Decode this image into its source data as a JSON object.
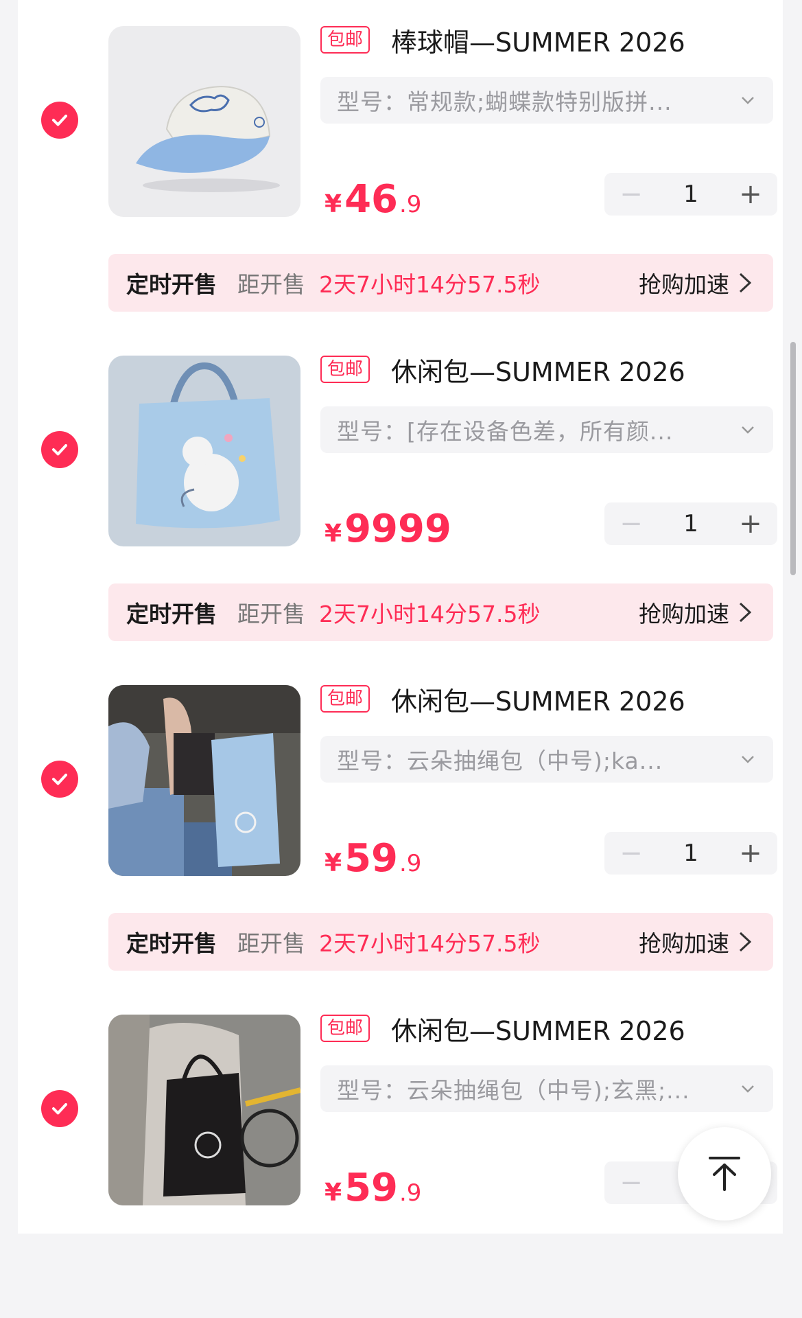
{
  "items": [
    {
      "badge": "包邮",
      "title": "棒球帽—SUMMER 2026",
      "variant": "型号：常规款;蝴蝶款特别版拼...",
      "price": {
        "currency": "¥",
        "integer": "46",
        "decimal": ".9"
      },
      "quantity": "1",
      "timer": {
        "label": "定时开售",
        "prefix": "距开售",
        "countdown": "2天7小时14分57.5秒",
        "boost": "抢购加速"
      }
    },
    {
      "badge": "包邮",
      "title": "休闲包—SUMMER 2026",
      "variant": "型号：[存在设备色差，所有颜...",
      "price": {
        "currency": "¥",
        "integer": "9999",
        "decimal": ""
      },
      "quantity": "1",
      "timer": {
        "label": "定时开售",
        "prefix": "距开售",
        "countdown": "2天7小时14分57.5秒",
        "boost": "抢购加速"
      }
    },
    {
      "badge": "包邮",
      "title": "休闲包—SUMMER 2026",
      "variant": "型号：云朵抽绳包（中号);ka...",
      "price": {
        "currency": "¥",
        "integer": "59",
        "decimal": ".9"
      },
      "quantity": "1",
      "timer": {
        "label": "定时开售",
        "prefix": "距开售",
        "countdown": "2天7小时14分57.5秒",
        "boost": "抢购加速"
      }
    },
    {
      "badge": "包邮",
      "title": "休闲包—SUMMER 2026",
      "variant": "型号：云朵抽绳包（中号);玄黑;...",
      "price": {
        "currency": "¥",
        "integer": "59",
        "decimal": ".9"
      },
      "quantity": "",
      "timer": null
    }
  ],
  "colors": {
    "accent": "#fe2c55",
    "timer_bg": "#fde8ec",
    "field_bg": "#f4f4f6"
  },
  "icons": {
    "check": "check-icon",
    "dropdown": "chevron-down-icon",
    "timer": "chevron-right-icon",
    "back_to_top": "arrow-up-icon"
  }
}
